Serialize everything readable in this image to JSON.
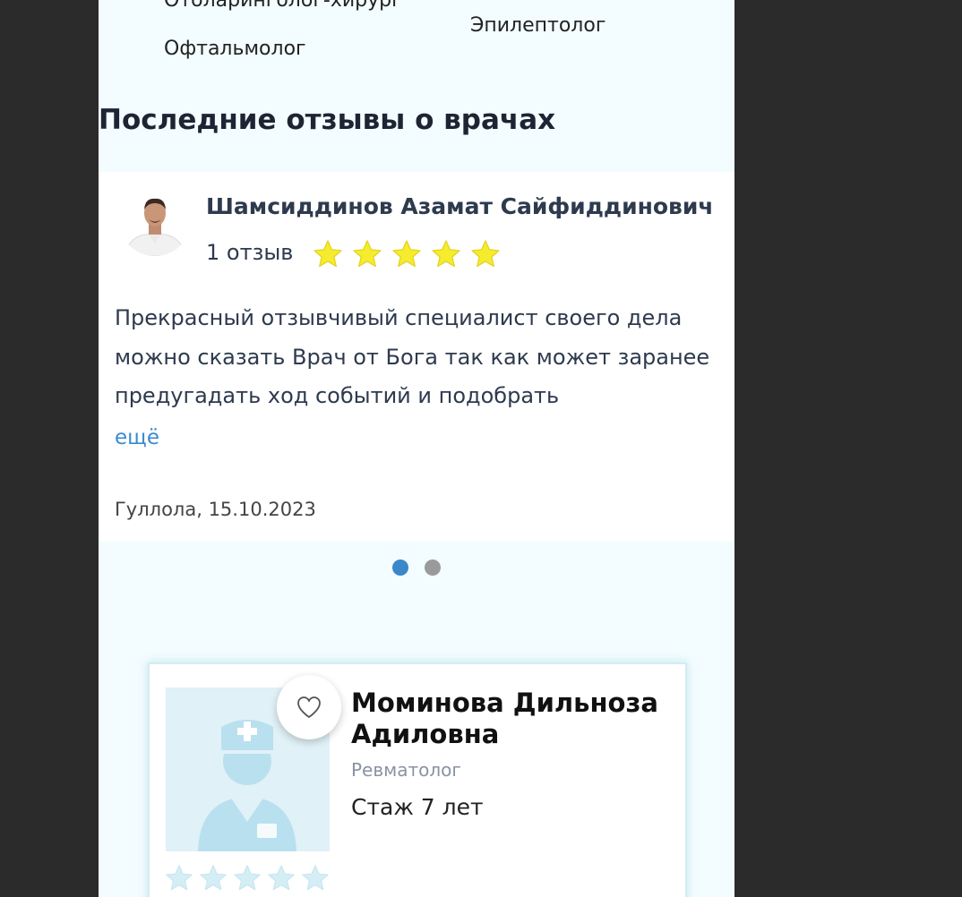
{
  "specialties": {
    "left": [
      "Отоларинголог-хирург",
      "Офтальмолог"
    ],
    "right": [
      "Эпилептолог"
    ]
  },
  "reviews_section": {
    "title": "Последние отзывы о врачах",
    "review": {
      "doctor_name": "Шамсиддинов Азамат Сайфиддинович",
      "review_count": "1 отзыв",
      "rating": 5,
      "star_color": "#f5ec2e",
      "text": "Прекрасный отзывчивый специалист своего дела можно сказать Врач от Бога так как может заранее предугадать ход событий и подобрать",
      "more_label": "ещё",
      "author_date": "Гуллола, 15.10.2023"
    },
    "carousel": {
      "slides": 2,
      "active": 1
    }
  },
  "doctor_card": {
    "name": "Моминова Дильноза Адиловна",
    "specialty": "Ревматолог",
    "experience": "Стаж 7 лет",
    "rating": 0,
    "favorite_icon": "heart-outline-icon",
    "photo": "doctor-placeholder-icon"
  },
  "colors": {
    "page_background": "#f3fcfe",
    "outer_background": "#2b2b2b",
    "link": "#3a8bd0",
    "dot_active": "#3a87c9",
    "dot_inactive": "#9a9a9a",
    "placeholder_star": "#d5eef6"
  }
}
